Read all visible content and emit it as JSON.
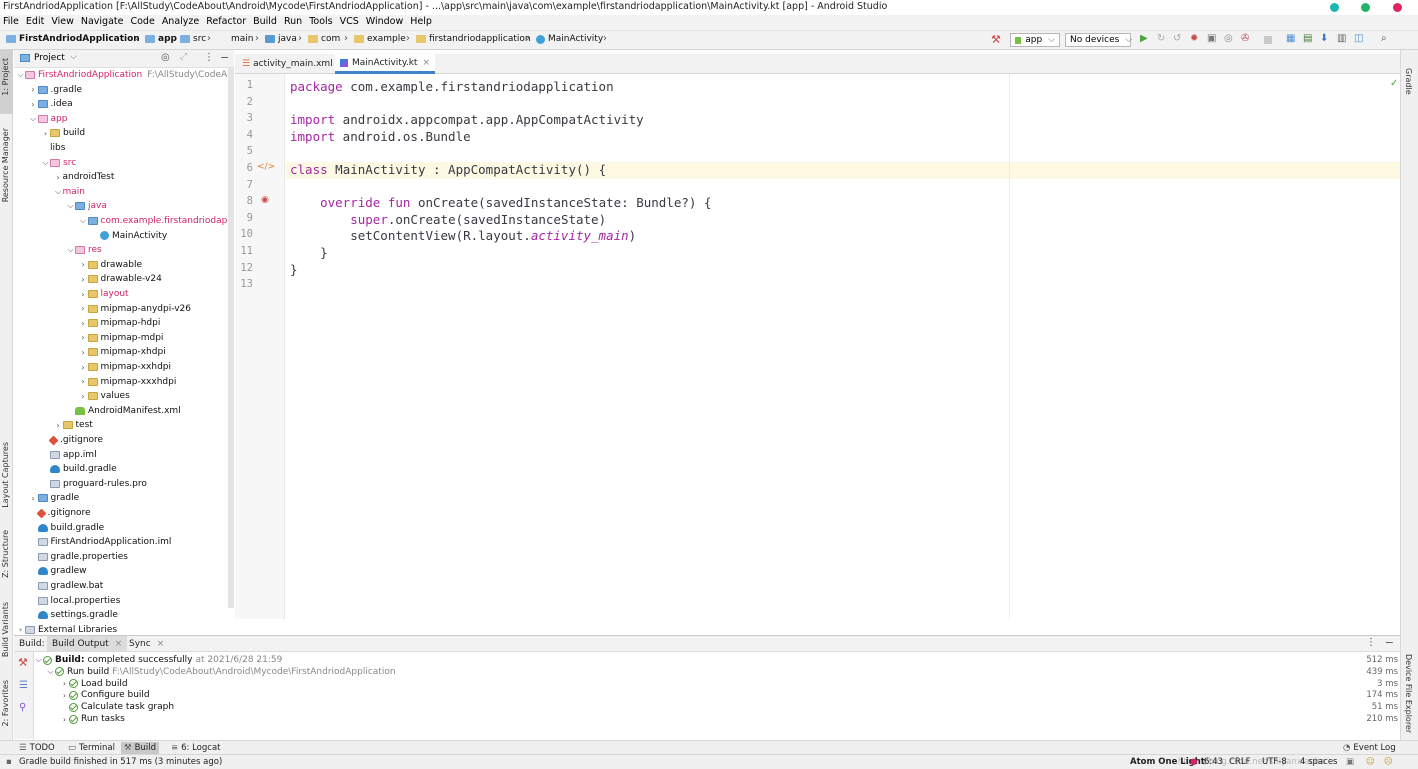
{
  "window": {
    "title": "FirstAndriodApplication [F:\\AllStudy\\CodeAbout\\Android\\Mycode\\FirstAndriodApplication] - ...\\app\\src\\main\\java\\com\\example\\firstandriodapplication\\MainActivity.kt [app] - Android Studio"
  },
  "menu": [
    "File",
    "Edit",
    "View",
    "Navigate",
    "Code",
    "Analyze",
    "Refactor",
    "Build",
    "Run",
    "Tools",
    "VCS",
    "Window",
    "Help"
  ],
  "breadcrumb": {
    "project": "FirstAndriodApplication",
    "app": "app",
    "src": "src",
    "main": "main",
    "java": "java",
    "com": "com",
    "example": "example",
    "pkg": "firstandriodapplication",
    "file": "MainActivity"
  },
  "toolbar": {
    "config": "app",
    "device": "No devices"
  },
  "left_strip": {
    "project": "1: Project",
    "resource": "Resource Manager",
    "layout": "Layout Captures",
    "structure": "Z: Structure",
    "variants": "Build Variants",
    "favorites": "2: Favorites"
  },
  "right_strip": {
    "gradle": "Gradle",
    "explorer": "Device File Explorer"
  },
  "project_panel": {
    "title": "Project"
  },
  "tree": [
    {
      "label": "FirstAndriodApplication",
      "hint": "F:\\AllStudy\\CodeAbout",
      "depth": 0,
      "arrow": "v",
      "icon": "module",
      "red": true
    },
    {
      "label": ".gradle",
      "depth": 1,
      "arrow": ">",
      "icon": "folderb"
    },
    {
      "label": ".idea",
      "depth": 1,
      "arrow": ">",
      "icon": "folderb"
    },
    {
      "label": "app",
      "depth": 1,
      "arrow": "v",
      "icon": "folderp",
      "red": true
    },
    {
      "label": "build",
      "depth": 2,
      "arrow": ">",
      "icon": "folderr"
    },
    {
      "label": "libs",
      "depth": 2,
      "arrow": "",
      "icon": "none"
    },
    {
      "label": "src",
      "depth": 2,
      "arrow": "v",
      "icon": "folderp",
      "red": true
    },
    {
      "label": "androidTest",
      "depth": 3,
      "arrow": ">",
      "icon": "none"
    },
    {
      "label": "main",
      "depth": 3,
      "arrow": "v",
      "icon": "none",
      "red": true
    },
    {
      "label": "java",
      "depth": 4,
      "arrow": "v",
      "icon": "folderb",
      "red": true
    },
    {
      "label": "com.example.firstandriodapplica",
      "depth": 5,
      "arrow": "v",
      "icon": "folderb",
      "red": true
    },
    {
      "label": "MainActivity",
      "depth": 6,
      "arrow": "",
      "icon": "kotlin"
    },
    {
      "label": "res",
      "depth": 4,
      "arrow": "v",
      "icon": "folderp",
      "red": true
    },
    {
      "label": "drawable",
      "depth": 5,
      "arrow": ">",
      "icon": "folder"
    },
    {
      "label": "drawable-v24",
      "depth": 5,
      "arrow": ">",
      "icon": "folder"
    },
    {
      "label": "layout",
      "depth": 5,
      "arrow": ">",
      "icon": "folder",
      "red": true
    },
    {
      "label": "mipmap-anydpi-v26",
      "depth": 5,
      "arrow": ">",
      "icon": "folder"
    },
    {
      "label": "mipmap-hdpi",
      "depth": 5,
      "arrow": ">",
      "icon": "folder"
    },
    {
      "label": "mipmap-mdpi",
      "depth": 5,
      "arrow": ">",
      "icon": "folder"
    },
    {
      "label": "mipmap-xhdpi",
      "depth": 5,
      "arrow": ">",
      "icon": "folder"
    },
    {
      "label": "mipmap-xxhdpi",
      "depth": 5,
      "arrow": ">",
      "icon": "folder"
    },
    {
      "label": "mipmap-xxxhdpi",
      "depth": 5,
      "arrow": ">",
      "icon": "folder"
    },
    {
      "label": "values",
      "depth": 5,
      "arrow": ">",
      "icon": "folder"
    },
    {
      "label": "AndroidManifest.xml",
      "depth": 4,
      "arrow": "",
      "icon": "android"
    },
    {
      "label": "test",
      "depth": 3,
      "arrow": ">",
      "icon": "foldert"
    },
    {
      "label": ".gitignore",
      "depth": 2,
      "arrow": "",
      "icon": "git"
    },
    {
      "label": "app.iml",
      "depth": 2,
      "arrow": "",
      "icon": "file"
    },
    {
      "label": "build.gradle",
      "depth": 2,
      "arrow": "",
      "icon": "gradle"
    },
    {
      "label": "proguard-rules.pro",
      "depth": 2,
      "arrow": "",
      "icon": "file"
    },
    {
      "label": "gradle",
      "depth": 1,
      "arrow": ">",
      "icon": "folderb"
    },
    {
      "label": ".gitignore",
      "depth": 1,
      "arrow": "",
      "icon": "git"
    },
    {
      "label": "build.gradle",
      "depth": 1,
      "arrow": "",
      "icon": "gradle"
    },
    {
      "label": "FirstAndriodApplication.iml",
      "depth": 1,
      "arrow": "",
      "icon": "file"
    },
    {
      "label": "gradle.properties",
      "depth": 1,
      "arrow": "",
      "icon": "file"
    },
    {
      "label": "gradlew",
      "depth": 1,
      "arrow": "",
      "icon": "gradle"
    },
    {
      "label": "gradlew.bat",
      "depth": 1,
      "arrow": "",
      "icon": "file"
    },
    {
      "label": "local.properties",
      "depth": 1,
      "arrow": "",
      "icon": "file"
    },
    {
      "label": "settings.gradle",
      "depth": 1,
      "arrow": "",
      "icon": "gradle"
    },
    {
      "label": "External Libraries",
      "depth": 0,
      "arrow": ">",
      "icon": "lib"
    }
  ],
  "editor": {
    "tabs": [
      {
        "label": "activity_main.xml"
      },
      {
        "label": "MainActivity.kt"
      }
    ],
    "line_numbers": [
      "1",
      "2",
      "3",
      "4",
      "5",
      "6",
      "7",
      "8",
      "9",
      "10",
      "11",
      "12",
      "13"
    ],
    "lines": [
      [
        [
          "kw",
          "package"
        ],
        [
          "p",
          " com.example.firstandriodapplication"
        ]
      ],
      [],
      [
        [
          "kw",
          "import"
        ],
        [
          "p",
          " androidx.appcompat.app.AppCompatActivity"
        ]
      ],
      [
        [
          "kw",
          "import"
        ],
        [
          "p",
          " android.os.Bundle"
        ]
      ],
      [],
      [
        [
          "kw",
          "class"
        ],
        [
          "p",
          " MainActivity : AppCompatActivity() {"
        ]
      ],
      [],
      [
        [
          "p",
          "    "
        ],
        [
          "kw",
          "override fun"
        ],
        [
          "p",
          " onCreate(savedInstanceState: Bundle?) {"
        ]
      ],
      [
        [
          "p",
          "        "
        ],
        [
          "kw",
          "super"
        ],
        [
          "p",
          ".onCreate(savedInstanceState)"
        ]
      ],
      [
        [
          "p",
          "        setContentView(R.layout."
        ],
        [
          "it",
          "activity_main"
        ],
        [
          "p",
          ")"
        ]
      ],
      [
        [
          "p",
          "    }"
        ]
      ],
      [
        [
          "p",
          "}"
        ]
      ],
      []
    ]
  },
  "build": {
    "tabs": {
      "label": "Build:",
      "output": "Build Output",
      "sync": "Sync"
    },
    "rows": [
      {
        "label": "Build:",
        "text": "completed successfully",
        "hint": "at 2021/6/28 21:59",
        "time": "512 ms"
      },
      {
        "label": "Run build",
        "hint": "F:\\AllStudy\\CodeAbout\\Android\\Mycode\\FirstAndriodApplication",
        "time": "439 ms"
      },
      {
        "label": "Load build",
        "time": "3 ms"
      },
      {
        "label": "Configure build",
        "time": "174 ms"
      },
      {
        "label": "Calculate task graph",
        "time": "51 ms"
      },
      {
        "label": "Run tasks",
        "time": "210 ms"
      }
    ]
  },
  "bottom_tabs": [
    "TODO",
    "Terminal",
    "Build",
    "6: Logcat"
  ],
  "event_log": "Event Log",
  "status": {
    "message": "Gradle build finished in 517 ms (3 minutes ago)",
    "theme": "Atom One Light",
    "pos": "6:43",
    "crlf": "CRLF",
    "enc": "UTF-8",
    "indent": "4 spaces",
    "watermark": "https://blog.csdn.net/shiyanxiaoba"
  },
  "colors": {
    "accent": "#4083c9",
    "keyword": "#a626a4",
    "caret_line": "#fdf9e3"
  }
}
